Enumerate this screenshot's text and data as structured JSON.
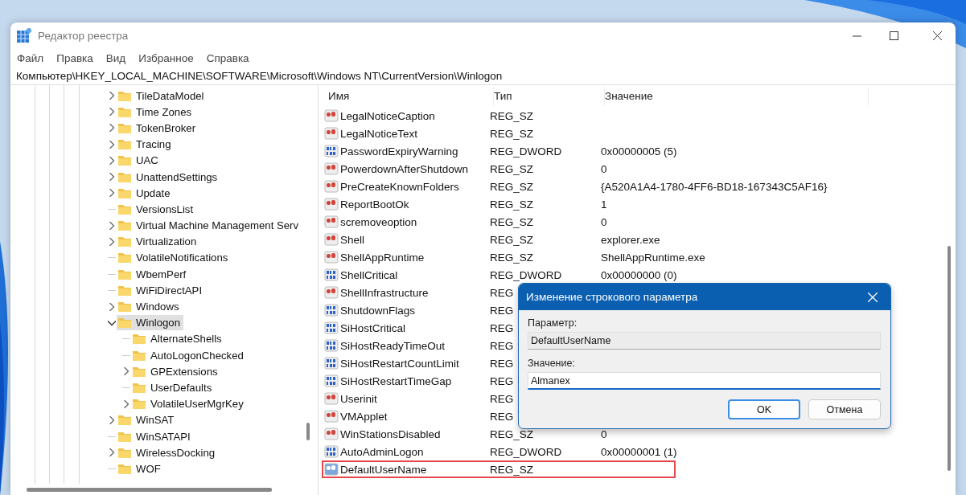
{
  "window": {
    "title": "Редактор реестра"
  },
  "menu": [
    "Файл",
    "Правка",
    "Вид",
    "Избранное",
    "Справка"
  ],
  "address": "Компьютер\\HKEY_LOCAL_MACHINE\\SOFTWARE\\Microsoft\\Windows NT\\CurrentVersion\\Winlogon",
  "tree": [
    {
      "label": "TileDataModel",
      "expandable": true,
      "expanded": false,
      "selected": false
    },
    {
      "label": "Time Zones",
      "expandable": true,
      "expanded": false,
      "selected": false
    },
    {
      "label": "TokenBroker",
      "expandable": true,
      "expanded": false,
      "selected": false
    },
    {
      "label": "Tracing",
      "expandable": true,
      "expanded": false,
      "selected": false
    },
    {
      "label": "UAC",
      "expandable": true,
      "expanded": false,
      "selected": false
    },
    {
      "label": "UnattendSettings",
      "expandable": true,
      "expanded": false,
      "selected": false
    },
    {
      "label": "Update",
      "expandable": true,
      "expanded": false,
      "selected": false
    },
    {
      "label": "VersionsList",
      "expandable": false,
      "selected": false
    },
    {
      "label": "Virtual Machine Management Serv",
      "expandable": true,
      "expanded": false,
      "selected": false
    },
    {
      "label": "Virtualization",
      "expandable": true,
      "expanded": false,
      "selected": false
    },
    {
      "label": "VolatileNotifications",
      "expandable": false,
      "selected": false
    },
    {
      "label": "WbemPerf",
      "expandable": false,
      "selected": false
    },
    {
      "label": "WiFiDirectAPI",
      "expandable": false,
      "selected": false
    },
    {
      "label": "Windows",
      "expandable": true,
      "expanded": false,
      "selected": false
    },
    {
      "label": "Winlogon",
      "expandable": true,
      "expanded": true,
      "selected": true,
      "children": [
        {
          "label": "AlternateShells",
          "expandable": false,
          "selected": false
        },
        {
          "label": "AutoLogonChecked",
          "expandable": false,
          "selected": false
        },
        {
          "label": "GPExtensions",
          "expandable": true,
          "expanded": false,
          "selected": false
        },
        {
          "label": "UserDefaults",
          "expandable": false,
          "selected": false
        },
        {
          "label": "VolatileUserMgrKey",
          "expandable": true,
          "expanded": false,
          "selected": false
        }
      ]
    },
    {
      "label": "WinSAT",
      "expandable": true,
      "expanded": false,
      "selected": false
    },
    {
      "label": "WinSATAPI",
      "expandable": false,
      "selected": false
    },
    {
      "label": "WirelessDocking",
      "expandable": true,
      "expanded": false,
      "selected": false
    },
    {
      "label": "WOF",
      "expandable": false,
      "selected": false
    }
  ],
  "columns": [
    "Имя",
    "Тип",
    "Значение"
  ],
  "rows": [
    {
      "name": "LegalNoticeCaption",
      "type": "REG_SZ",
      "kind": "string",
      "selected": false
    },
    {
      "name": "LegalNoticeText",
      "type": "REG_SZ",
      "kind": "string",
      "selected": false
    },
    {
      "name": "PasswordExpiryWarning",
      "type": "REG_DWORD",
      "value": "0x00000005 (5)",
      "kind": "dword",
      "selected": false
    },
    {
      "name": "PowerdownAfterShutdown",
      "type": "REG_SZ",
      "value": "0",
      "kind": "string",
      "selected": false
    },
    {
      "name": "PreCreateKnownFolders",
      "type": "REG_SZ",
      "value": "{A520A1A4-1780-4FF6-BD18-167343C5AF16}",
      "kind": "string",
      "selected": false
    },
    {
      "name": "ReportBootOk",
      "type": "REG_SZ",
      "value": "1",
      "kind": "string",
      "selected": false
    },
    {
      "name": "scremoveoption",
      "type": "REG_SZ",
      "value": "0",
      "kind": "string",
      "selected": false
    },
    {
      "name": "Shell",
      "type": "REG_SZ",
      "value": "explorer.exe",
      "kind": "string",
      "selected": false
    },
    {
      "name": "ShellAppRuntime",
      "type": "REG_SZ",
      "value": "ShellAppRuntime.exe",
      "kind": "string",
      "selected": false
    },
    {
      "name": "ShellCritical",
      "type": "REG_DWORD",
      "value": "0x00000000 (0)",
      "kind": "dword",
      "selected": false
    },
    {
      "name": "ShellInfrastructure",
      "type": "REG",
      "kind": "string",
      "selected": false
    },
    {
      "name": "ShutdownFlags",
      "type": "REG",
      "kind": "dword",
      "selected": false
    },
    {
      "name": "SiHostCritical",
      "type": "REG",
      "kind": "dword",
      "selected": false
    },
    {
      "name": "SiHostReadyTimeOut",
      "type": "REG",
      "kind": "dword",
      "selected": false
    },
    {
      "name": "SiHostRestartCountLimit",
      "type": "REG",
      "kind": "dword",
      "selected": false
    },
    {
      "name": "SiHostRestartTimeGap",
      "type": "REG",
      "kind": "dword",
      "selected": false
    },
    {
      "name": "Userinit",
      "type": "REG",
      "kind": "string",
      "selected": false
    },
    {
      "name": "VMApplet",
      "type": "REG",
      "kind": "string",
      "selected": false
    },
    {
      "name": "WinStationsDisabled",
      "type": "REG_SZ",
      "value": "0",
      "kind": "string",
      "selected": false
    },
    {
      "name": "AutoAdminLogon",
      "type": "REG_DWORD",
      "value": "0x00000001 (1)",
      "kind": "dword",
      "selected": false
    },
    {
      "name": "DefaultUserName",
      "type": "REG_SZ",
      "kind": "string",
      "selected": true
    }
  ],
  "dialog": {
    "title": "Изменение строкового параметра",
    "name_label": "Параметр:",
    "name_value": "DefaultUserName",
    "value_label": "Значение:",
    "value": "Almanex",
    "buttons": [
      {
        "label": "OK",
        "default": true
      },
      {
        "label": "Отмена",
        "default": false
      }
    ]
  }
}
